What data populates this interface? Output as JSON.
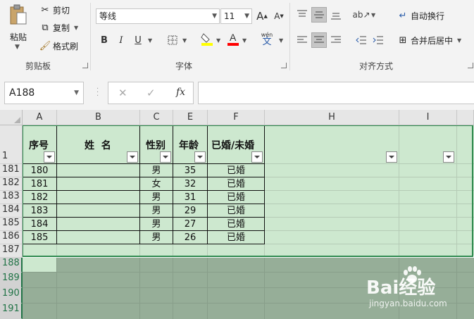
{
  "ribbon": {
    "clipboard": {
      "paste_label": "粘贴",
      "cut_label": "剪切",
      "copy_label": "复制",
      "format_painter_label": "格式刷",
      "group_label": "剪贴板"
    },
    "font": {
      "font_name": "等线",
      "font_size": "11",
      "grow_label": "A",
      "shrink_label": "A",
      "bold_label": "B",
      "italic_label": "I",
      "underline_label": "U",
      "phonetic_label": "wén",
      "phonetic_char": "文",
      "font_color_glyph": "A",
      "group_label": "字体"
    },
    "alignment": {
      "wrap_text_label": "自动换行",
      "merge_center_label": "合并后居中",
      "group_label": "对齐方式"
    }
  },
  "formula_bar": {
    "name_box": "A188",
    "cancel_glyph": "✕",
    "enter_glyph": "✓",
    "fx_label": "fx",
    "formula": ""
  },
  "grid": {
    "columns": [
      "A",
      "B",
      "C",
      "E",
      "F",
      "H",
      "I"
    ],
    "rows": [
      "1",
      "181",
      "182",
      "183",
      "184",
      "185",
      "186",
      "187",
      "188",
      "189",
      "190",
      "191"
    ],
    "header_row": {
      "seq": "序号",
      "name": "姓  名",
      "gender": "性别",
      "age": "年龄",
      "marital": "已婚/未婚"
    },
    "data_rows": [
      {
        "seq": "180",
        "gender": "男",
        "age": "35",
        "marital": "已婚"
      },
      {
        "seq": "181",
        "gender": "女",
        "age": "32",
        "marital": "已婚"
      },
      {
        "seq": "182",
        "gender": "男",
        "age": "31",
        "marital": "已婚"
      },
      {
        "seq": "183",
        "gender": "男",
        "age": "29",
        "marital": "已婚"
      },
      {
        "seq": "184",
        "gender": "男",
        "age": "27",
        "marital": "已婚"
      },
      {
        "seq": "185",
        "gender": "男",
        "age": "26",
        "marital": "已婚"
      }
    ]
  },
  "watermark": {
    "brand": "Bai经验",
    "url": "jingyan.baidu.com"
  },
  "colors": {
    "selection_fill": "#cde8cf",
    "selection_border": "#2f8a4f",
    "dim_fill": "#96ae98",
    "ribbon_bg": "#f3f3f3"
  }
}
